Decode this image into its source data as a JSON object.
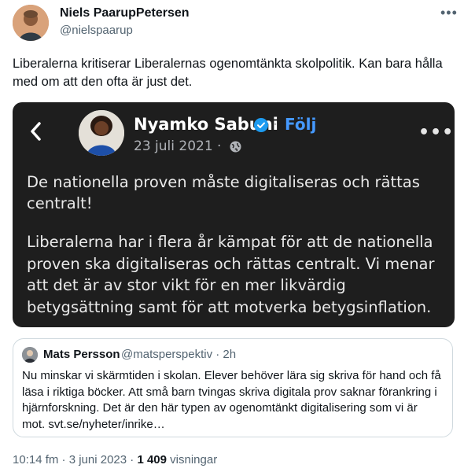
{
  "author": {
    "name": "Niels PaarupPetersen",
    "handle": "@nielspaarup"
  },
  "tweet_text": "Liberalerna kritiserar Liberalernas ogenomtänkta skolpolitik. Kan bara hålla med om att den ofta är just det.",
  "embedded_post": {
    "name": "Nyamko Sabuni",
    "follow_label": "Följ",
    "date": "23 juli 2021 ·",
    "paragraph1": "De nationella proven måste digitaliseras och rättas centralt!",
    "paragraph2": "Liberalerna har i flera år kämpat för att de nationella proven ska digitaliseras och rättas centralt. Vi menar att det är av stor vikt för en mer likvärdig betygsättning samt för att motverka betygsinflation.",
    "accent_color": "#4599ff",
    "background_color": "#1e1e1e"
  },
  "quoted_tweet": {
    "name": "Mats Persson",
    "handle_time": "@matsperspektiv · 2h",
    "text": "Nu minskar vi skärmtiden i skolan. Elever behöver lära sig skriva för hand och få läsa i riktiga böcker. Att små barn tvingas skriva digitala prov saknar förankring i hjärnforskning. Det är den här typen av ogenomtänkt digitalisering som vi är mot. svt.se/nyheter/inrike…"
  },
  "meta": {
    "time_date": "10:14 fm · 3 juni 2023 ·",
    "views_count": "1 409",
    "views_label": "visningar"
  },
  "icons": [
    "more-icon",
    "back-arrow-icon",
    "verified-badge-icon",
    "globe-icon"
  ]
}
